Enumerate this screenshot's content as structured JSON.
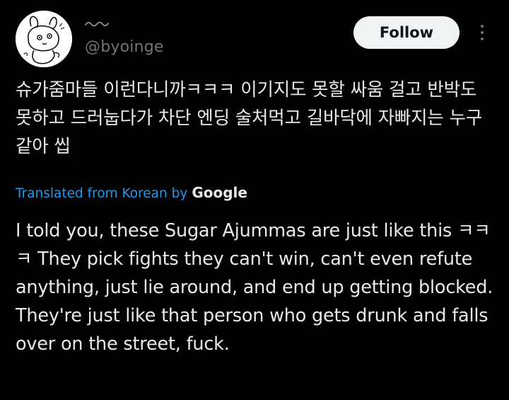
{
  "author": {
    "handle": "@byoinge",
    "avatar_icon": "cartoon-character-avatar"
  },
  "actions": {
    "follow_label": "Follow",
    "more_icon": "more-vertical-icon"
  },
  "tweet": {
    "original_text": "슈가줌마들 이런다니까ㅋㅋㅋ 이기지도 못할 싸움 걸고 반박도 못하고 드러눕다가 차단 엔딩 술처먹고 길바닥에 자빠지는 누구같아 씹",
    "translation_prefix": "Translated from Korean by",
    "translation_provider": "Google",
    "translated_text": "I told you, these Sugar Ajummas are just like this ㅋㅋㅋ They pick fights they can't win, can't even refute anything, just lie around, and end up getting blocked. They're just like that person who gets drunk and falls over on the street, fuck."
  },
  "colors": {
    "background": "#000000",
    "text_primary": "#e7e9ea",
    "text_secondary": "#71767b",
    "link": "#1d9bf0",
    "follow_button_bg": "#eff3f4",
    "follow_button_text": "#0f1419"
  }
}
